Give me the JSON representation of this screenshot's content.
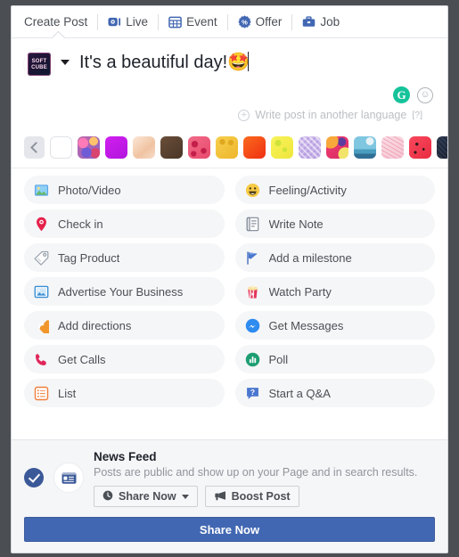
{
  "tabs": [
    {
      "label": "Create Post",
      "icon": "none",
      "active": true
    },
    {
      "label": "Live",
      "icon": "live-icon",
      "active": false
    },
    {
      "label": "Event",
      "icon": "event-icon",
      "active": false
    },
    {
      "label": "Offer",
      "icon": "offer-icon",
      "active": false
    },
    {
      "label": "Job",
      "icon": "job-icon",
      "active": false
    }
  ],
  "composer": {
    "avatar_line1": "SOFT",
    "avatar_line2": "CUBE",
    "post_text": "It's a beautiful day!",
    "post_emoji": "🤩",
    "grammarly_glyph": "G",
    "emoji_glyph": "☺",
    "language_label": "Write post in another language",
    "language_help": "[?]",
    "plus_glyph": "+"
  },
  "backgrounds": {
    "prev_label": "previous backgrounds",
    "swatches": [
      {
        "name": "no-background",
        "color": "#ffffff"
      },
      {
        "name": "confetti-purple",
        "color": "#c16aa8"
      },
      {
        "name": "magenta",
        "color": "#c215e8"
      },
      {
        "name": "peach",
        "color": "#f5d2bc"
      },
      {
        "name": "dark-brown",
        "color": "#5b4434"
      },
      {
        "name": "pink-petals",
        "color": "#ee5f7e"
      },
      {
        "name": "yellow-gold",
        "color": "#f0c33c"
      },
      {
        "name": "orange-red",
        "color": "#f4511e"
      },
      {
        "name": "lemon-yellow",
        "color": "#f5ed4b"
      },
      {
        "name": "lavender-pattern",
        "color": "#cbb6e8"
      },
      {
        "name": "pink-swirl",
        "color": "#e8376a"
      },
      {
        "name": "sky-blue",
        "color": "#63b8d8"
      },
      {
        "name": "blush-pink",
        "color": "#f6cfd8"
      },
      {
        "name": "watermelon",
        "color": "#f03c4e"
      },
      {
        "name": "navy-dots",
        "color": "#1e2b42"
      }
    ]
  },
  "options": [
    {
      "label": "Photo/Video",
      "icon": "photo-video-icon"
    },
    {
      "label": "Feeling/Activity",
      "icon": "feeling-activity-icon"
    },
    {
      "label": "Check in",
      "icon": "check-in-icon"
    },
    {
      "label": "Write Note",
      "icon": "write-note-icon"
    },
    {
      "label": "Tag Product",
      "icon": "tag-product-icon"
    },
    {
      "label": "Add a milestone",
      "icon": "milestone-icon"
    },
    {
      "label": "Advertise Your Business",
      "icon": "advertise-icon"
    },
    {
      "label": "Watch Party",
      "icon": "watch-party-icon"
    },
    {
      "label": "Add directions",
      "icon": "directions-icon"
    },
    {
      "label": "Get Messages",
      "icon": "messenger-icon"
    },
    {
      "label": "Get Calls",
      "icon": "phone-icon"
    },
    {
      "label": "Poll",
      "icon": "poll-icon"
    },
    {
      "label": "List",
      "icon": "list-icon"
    },
    {
      "label": "Start a Q&A",
      "icon": "qa-icon"
    }
  ],
  "footer": {
    "audience_title": "News Feed",
    "audience_desc": "Posts are public and show up on your Page and in search results.",
    "share_now_dropdown": "Share Now",
    "boost_post": "Boost Post",
    "share_now_button": "Share Now"
  },
  "colors": {
    "brand_blue": "#4267b2",
    "icon_blue": "#4267b2",
    "grammarly_green": "#15c39a",
    "panel_gray": "#f5f6f7"
  }
}
